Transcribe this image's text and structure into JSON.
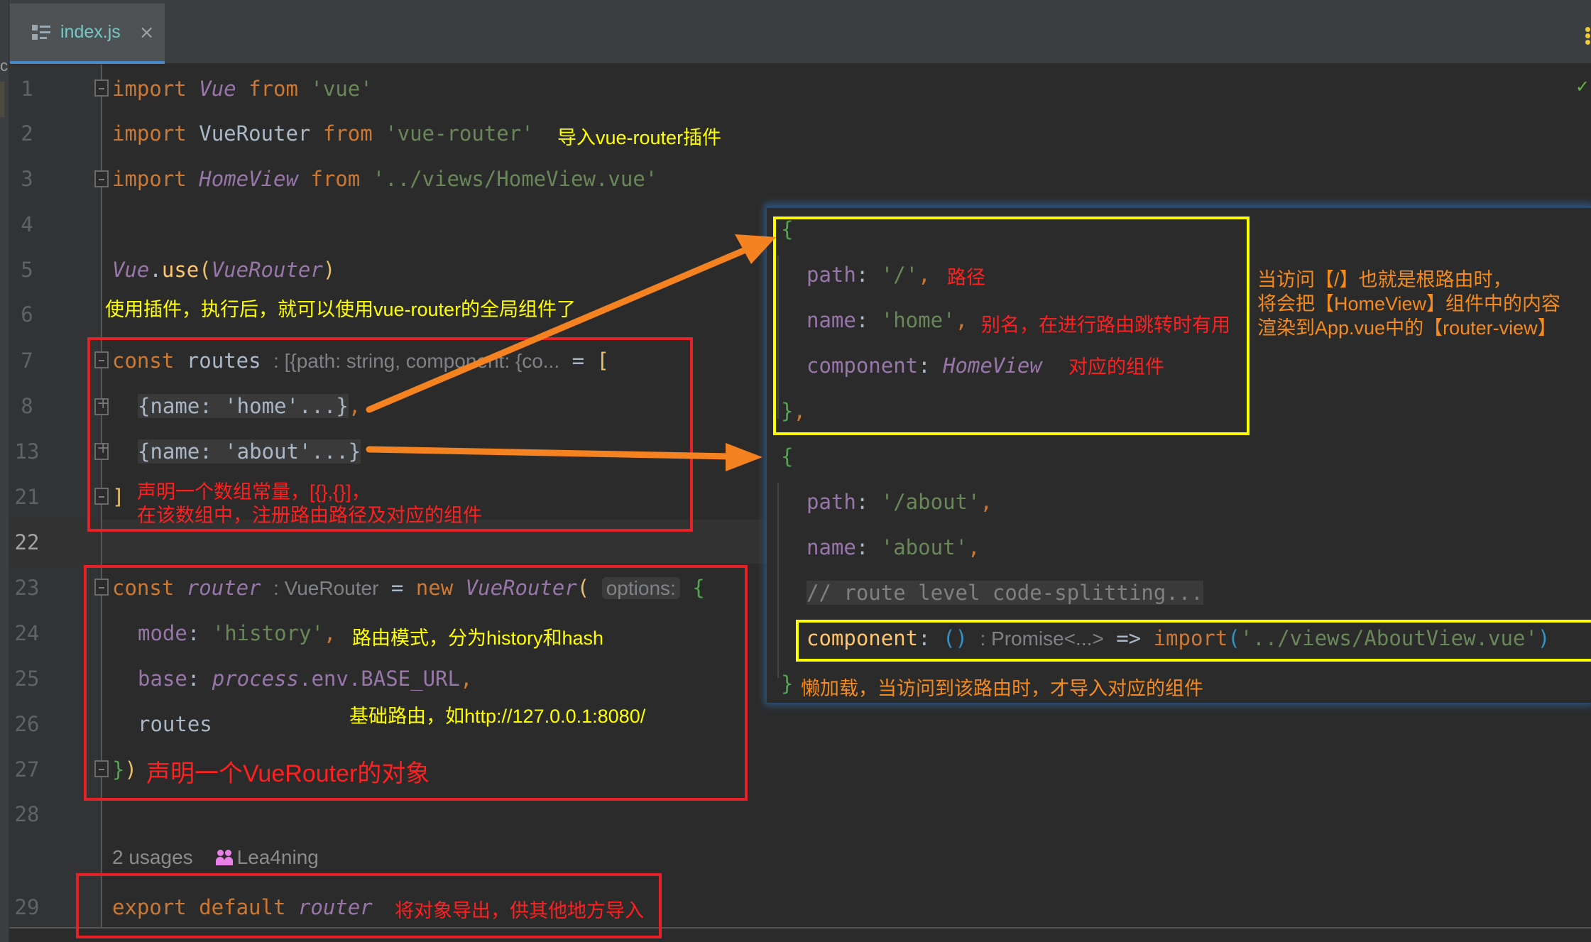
{
  "tab": {
    "title": "index.js",
    "close_icon": "×"
  },
  "left_strip_char": "c",
  "line_numbers": [
    "1",
    "2",
    "3",
    "4",
    "5",
    "6",
    "7",
    "8",
    "13",
    "21",
    "22",
    "23",
    "24",
    "25",
    "26",
    "27",
    "28",
    "29"
  ],
  "code": {
    "l1": {
      "kw1": "import",
      "cls": "Vue",
      "kw2": "from",
      "str": "'vue'"
    },
    "l2": {
      "kw1": "import",
      "plain": "VueRouter",
      "kw2": "from",
      "str": "'vue-router'"
    },
    "l3": {
      "kw1": "import",
      "cls": "HomeView",
      "kw2": "from",
      "str": "'../views/HomeView.vue'"
    },
    "l5": {
      "obj": "Vue",
      "dot": ".",
      "fn": "use",
      "open": "(",
      "arg": "VueRouter",
      "close": ")"
    },
    "l7": {
      "kw": "const",
      "name": "routes",
      "hint": ": [{path: string, component: {co...",
      "eq": " = ",
      "bracket": "["
    },
    "l8": {
      "folded": "{name: 'home'...}",
      "comma": ","
    },
    "l13": {
      "folded": "{name: 'about'...}"
    },
    "l21": {
      "bracket": "]"
    },
    "l23": {
      "kw": "const",
      "name": "router",
      "hint": ": VueRouter",
      "eq": " = ",
      "kw_new": "new",
      "cls": "VueRouter",
      "paren": "(",
      "param_hint": "options:",
      "brace": "{"
    },
    "l24": {
      "prop": "mode",
      "colon": ": ",
      "str": "'history'",
      "comma": ","
    },
    "l25": {
      "prop": "base",
      "colon": ": ",
      "obj": "process",
      "rest": ".env.BASE_URL",
      "comma": ","
    },
    "l26": {
      "plain": "routes"
    },
    "l27": {
      "brace": "}",
      "paren": ")"
    },
    "l29": {
      "kw": "export default",
      "name": "router"
    }
  },
  "usages": {
    "count": "2 usages",
    "author": "Lea4ning"
  },
  "annotations": {
    "import_plugin": "导入vue-router插件",
    "use_plugin": "使用插件，执行后，就可以使用vue-router的全局组件了",
    "routes_array_1": "声明一个数组常量，[{},{}]，",
    "routes_array_2": "在该数组中，注册路由路径及对应的组件",
    "mode": "路由模式，分为history和hash",
    "base": "基础路由，如http://127.0.0.1:8080/",
    "router_obj": "声明一个VueRouter的对象",
    "export": "将对象导出，供其他地方导入",
    "path": "路径",
    "name": "别名，在进行路由跳转时有用",
    "component": "对应的组件",
    "root_1": "当访问【/】也就是根路由时，",
    "root_2": "将会把【HomeView】组件中的内容",
    "root_3": "渲染到App.vue中的【router-view】",
    "lazy": "懒加载，当访问到该路由时，才导入对应的组件"
  },
  "popup": {
    "home": {
      "open": "{",
      "path_key": "path",
      "path_val": "'/'",
      "name_key": "name",
      "name_val": "'home'",
      "comp_key": "component",
      "comp_val": "HomeView",
      "close": "}",
      "comma": ","
    },
    "about": {
      "open": "{",
      "path_key": "path",
      "path_val": "'/about'",
      "name_key": "name",
      "name_val": "'about'",
      "comment": "// route level code-splitting...",
      "comp_key": "component",
      "comp_parens": "()",
      "comp_hint": ": Promise<...>",
      "arrow": " => ",
      "import_kw": "import",
      "import_open": "(",
      "import_str": "'../views/AboutView.vue'",
      "import_close": ")",
      "close": "}"
    }
  },
  "colors": {
    "keyword": "#cc7832",
    "class": "#9876aa",
    "string": "#6a8759",
    "default": "#a9b7c6",
    "annotation_red": "#e52127",
    "annotation_yellow": "#ffff00",
    "annotation_orange": "#f58a1f",
    "arrow": "#f58220",
    "tab_underline": "#4a88c7"
  }
}
